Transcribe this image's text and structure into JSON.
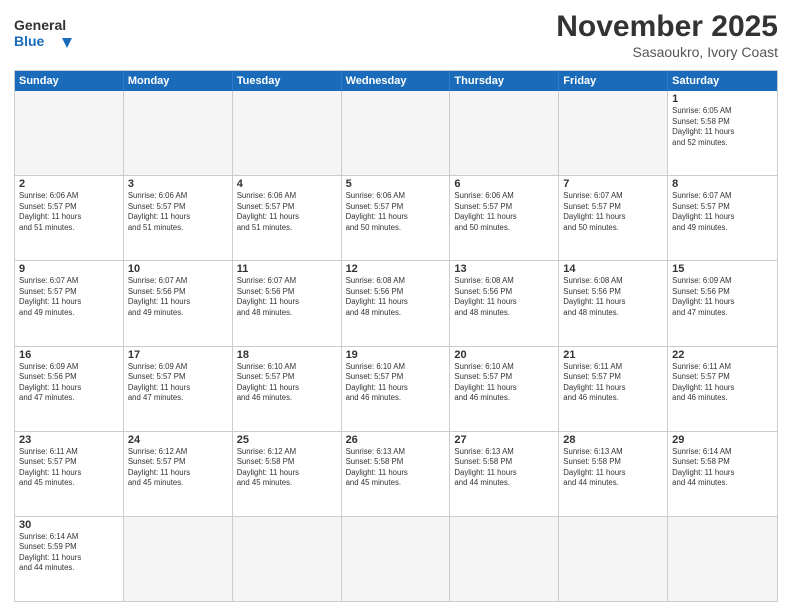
{
  "header": {
    "logo_general": "General",
    "logo_blue": "Blue",
    "title": "November 2025",
    "subtitle": "Sasaoukro, Ivory Coast"
  },
  "days_of_week": [
    "Sunday",
    "Monday",
    "Tuesday",
    "Wednesday",
    "Thursday",
    "Friday",
    "Saturday"
  ],
  "weeks": [
    [
      {
        "day": "",
        "info": ""
      },
      {
        "day": "",
        "info": ""
      },
      {
        "day": "",
        "info": ""
      },
      {
        "day": "",
        "info": ""
      },
      {
        "day": "",
        "info": ""
      },
      {
        "day": "",
        "info": ""
      },
      {
        "day": "1",
        "info": "Sunrise: 6:05 AM\nSunset: 5:58 PM\nDaylight: 11 hours\nand 52 minutes."
      }
    ],
    [
      {
        "day": "2",
        "info": "Sunrise: 6:06 AM\nSunset: 5:57 PM\nDaylight: 11 hours\nand 51 minutes."
      },
      {
        "day": "3",
        "info": "Sunrise: 6:06 AM\nSunset: 5:57 PM\nDaylight: 11 hours\nand 51 minutes."
      },
      {
        "day": "4",
        "info": "Sunrise: 6:06 AM\nSunset: 5:57 PM\nDaylight: 11 hours\nand 51 minutes."
      },
      {
        "day": "5",
        "info": "Sunrise: 6:06 AM\nSunset: 5:57 PM\nDaylight: 11 hours\nand 50 minutes."
      },
      {
        "day": "6",
        "info": "Sunrise: 6:06 AM\nSunset: 5:57 PM\nDaylight: 11 hours\nand 50 minutes."
      },
      {
        "day": "7",
        "info": "Sunrise: 6:07 AM\nSunset: 5:57 PM\nDaylight: 11 hours\nand 50 minutes."
      },
      {
        "day": "8",
        "info": "Sunrise: 6:07 AM\nSunset: 5:57 PM\nDaylight: 11 hours\nand 49 minutes."
      }
    ],
    [
      {
        "day": "9",
        "info": "Sunrise: 6:07 AM\nSunset: 5:57 PM\nDaylight: 11 hours\nand 49 minutes."
      },
      {
        "day": "10",
        "info": "Sunrise: 6:07 AM\nSunset: 5:56 PM\nDaylight: 11 hours\nand 49 minutes."
      },
      {
        "day": "11",
        "info": "Sunrise: 6:07 AM\nSunset: 5:56 PM\nDaylight: 11 hours\nand 48 minutes."
      },
      {
        "day": "12",
        "info": "Sunrise: 6:08 AM\nSunset: 5:56 PM\nDaylight: 11 hours\nand 48 minutes."
      },
      {
        "day": "13",
        "info": "Sunrise: 6:08 AM\nSunset: 5:56 PM\nDaylight: 11 hours\nand 48 minutes."
      },
      {
        "day": "14",
        "info": "Sunrise: 6:08 AM\nSunset: 5:56 PM\nDaylight: 11 hours\nand 48 minutes."
      },
      {
        "day": "15",
        "info": "Sunrise: 6:09 AM\nSunset: 5:56 PM\nDaylight: 11 hours\nand 47 minutes."
      }
    ],
    [
      {
        "day": "16",
        "info": "Sunrise: 6:09 AM\nSunset: 5:56 PM\nDaylight: 11 hours\nand 47 minutes."
      },
      {
        "day": "17",
        "info": "Sunrise: 6:09 AM\nSunset: 5:57 PM\nDaylight: 11 hours\nand 47 minutes."
      },
      {
        "day": "18",
        "info": "Sunrise: 6:10 AM\nSunset: 5:57 PM\nDaylight: 11 hours\nand 46 minutes."
      },
      {
        "day": "19",
        "info": "Sunrise: 6:10 AM\nSunset: 5:57 PM\nDaylight: 11 hours\nand 46 minutes."
      },
      {
        "day": "20",
        "info": "Sunrise: 6:10 AM\nSunset: 5:57 PM\nDaylight: 11 hours\nand 46 minutes."
      },
      {
        "day": "21",
        "info": "Sunrise: 6:11 AM\nSunset: 5:57 PM\nDaylight: 11 hours\nand 46 minutes."
      },
      {
        "day": "22",
        "info": "Sunrise: 6:11 AM\nSunset: 5:57 PM\nDaylight: 11 hours\nand 46 minutes."
      }
    ],
    [
      {
        "day": "23",
        "info": "Sunrise: 6:11 AM\nSunset: 5:57 PM\nDaylight: 11 hours\nand 45 minutes."
      },
      {
        "day": "24",
        "info": "Sunrise: 6:12 AM\nSunset: 5:57 PM\nDaylight: 11 hours\nand 45 minutes."
      },
      {
        "day": "25",
        "info": "Sunrise: 6:12 AM\nSunset: 5:58 PM\nDaylight: 11 hours\nand 45 minutes."
      },
      {
        "day": "26",
        "info": "Sunrise: 6:13 AM\nSunset: 5:58 PM\nDaylight: 11 hours\nand 45 minutes."
      },
      {
        "day": "27",
        "info": "Sunrise: 6:13 AM\nSunset: 5:58 PM\nDaylight: 11 hours\nand 44 minutes."
      },
      {
        "day": "28",
        "info": "Sunrise: 6:13 AM\nSunset: 5:58 PM\nDaylight: 11 hours\nand 44 minutes."
      },
      {
        "day": "29",
        "info": "Sunrise: 6:14 AM\nSunset: 5:58 PM\nDaylight: 11 hours\nand 44 minutes."
      }
    ],
    [
      {
        "day": "30",
        "info": "Sunrise: 6:14 AM\nSunset: 5:59 PM\nDaylight: 11 hours\nand 44 minutes."
      },
      {
        "day": "",
        "info": ""
      },
      {
        "day": "",
        "info": ""
      },
      {
        "day": "",
        "info": ""
      },
      {
        "day": "",
        "info": ""
      },
      {
        "day": "",
        "info": ""
      },
      {
        "day": "",
        "info": ""
      }
    ]
  ]
}
